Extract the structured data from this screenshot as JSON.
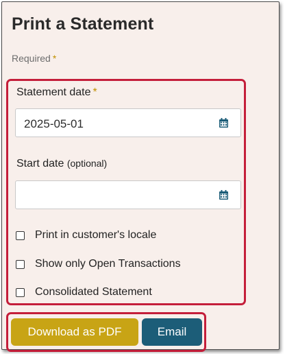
{
  "dialog": {
    "title": "Print a Statement",
    "required_label": "Required",
    "required_marker": "*"
  },
  "form": {
    "statement_date": {
      "label": "Statement date",
      "marker": "*",
      "value": "2025-05-01",
      "icon": "calendar-icon"
    },
    "start_date": {
      "label": "Start date",
      "qualifier": "(optional)",
      "value": "",
      "icon": "calendar-icon"
    },
    "checkboxes": [
      {
        "label": "Print in customer's locale",
        "checked": false
      },
      {
        "label": "Show only Open Transactions",
        "checked": false
      },
      {
        "label": "Consolidated Statement",
        "checked": false
      }
    ]
  },
  "actions": {
    "download_pdf": "Download as PDF",
    "email": "Email"
  },
  "colors": {
    "panel_bg": "#f8efeb",
    "highlight_border": "#c41e3a",
    "primary_button": "#c8a415",
    "secondary_button": "#1c5d78",
    "icon": "#1c5d78",
    "required_marker": "#c19000"
  }
}
